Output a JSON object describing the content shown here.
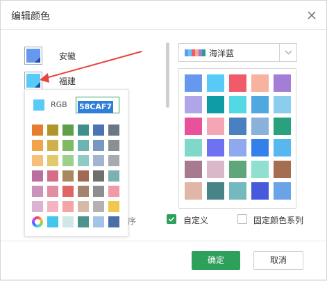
{
  "dialog": {
    "title": "编辑颜色"
  },
  "rows": [
    {
      "label": "安徽",
      "color": "#6699ee"
    },
    {
      "label": "福建",
      "color": "#58caf7"
    }
  ],
  "popover": {
    "rgb_label": "RGB",
    "rgb_value": "58CAF7",
    "current_color": "#58caf7",
    "palette": [
      [
        "#e67e30",
        "#b0962a",
        "#5e9f49",
        "#3f8f8c",
        "#4a74b4",
        "#6b7785"
      ],
      [
        "#f2a44c",
        "#cfb04a",
        "#7dba62",
        "#6bb4b0",
        "#7898c4",
        "#8a8f96"
      ],
      [
        "#f6c07a",
        "#e2c96c",
        "#9dd08c",
        "#8fcac6",
        "#a3b4d3",
        "#a7abb0"
      ],
      [
        "#ba6ea1",
        "#d46d87",
        "#a8885f",
        "#a16a55",
        "#6f6f6f",
        "#7ab2b0"
      ],
      [
        "#c993bb",
        "#e28ea0",
        "#e16567",
        "#a4846e",
        "#8e8e8e",
        "#f19aa6"
      ],
      [
        "#dbb3d2",
        "#f4b3c2",
        "#f6a3a6",
        "#d6b9a6",
        "#b5b1b1",
        "#f1c84d"
      ],
      [
        "wheel",
        "#44c6ec",
        "#cfe7e7",
        "#4a938f",
        "#a3c4e7",
        "#4a6ea8"
      ]
    ]
  },
  "scheme": {
    "name": "海洋蓝",
    "icon_colors": [
      "#6699ee",
      "#58caf7",
      "#f15a6a",
      "#f7a98f",
      "#9c7ed6",
      "#2a9d8f"
    ],
    "grid": [
      [
        "#6699ee",
        "#58caf7",
        "#f15a6a",
        "#f7b2a0",
        "#a47dd6"
      ],
      [
        "#aea6e9",
        "#109ca6",
        "#53d9e6",
        "#4fa8e0",
        "#8acded"
      ],
      [
        "#e9529b",
        "#f5a6b5",
        "#4a7fc0",
        "#8ab1da",
        "#29a07e"
      ],
      [
        "#7fd8c9",
        "#6e72f2",
        "#8fa8ee",
        "#3380ea",
        "#56b8ee"
      ],
      [
        "#a77a92",
        "#d9b9c9",
        "#5fa77a",
        "#8fe0d1",
        "#a66e51"
      ],
      [
        "#e2b6a6",
        "#478487",
        "#74b9bf",
        "#4959dc",
        "#6aa3e6"
      ]
    ]
  },
  "options": {
    "custom_label": "自定义",
    "custom_checked": true,
    "fixed_label": "固定颜色系列",
    "fixed_checked": false,
    "hidden_fragment": "序"
  },
  "footer": {
    "ok": "确定",
    "cancel": "取消"
  },
  "colors": {
    "accent": "#2ea05b",
    "pointer_arrow": "#e8443c",
    "selection": "#2f7fd9"
  }
}
